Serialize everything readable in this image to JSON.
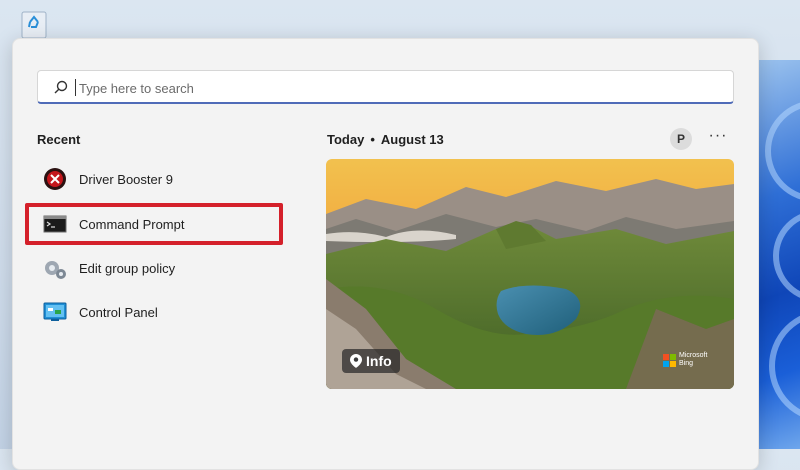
{
  "search": {
    "placeholder": "Type here to search"
  },
  "recent": {
    "label": "Recent",
    "items": [
      {
        "label": "Driver Booster 9",
        "icon": "driver-booster-icon"
      },
      {
        "label": "Command Prompt",
        "icon": "command-prompt-icon"
      },
      {
        "label": "Edit group policy",
        "icon": "group-policy-icon"
      },
      {
        "label": "Control Panel",
        "icon": "control-panel-icon"
      }
    ]
  },
  "today": {
    "label": "Today",
    "separator": "•",
    "date": "August 13"
  },
  "account": {
    "initial": "P"
  },
  "more": {
    "label": "···"
  },
  "bing_card": {
    "info_label": "Info",
    "brand_line1": "Microsoft",
    "brand_line2": "Bing"
  },
  "colors": {
    "highlight": "#d4202a",
    "search_underline": "#4f6bb8",
    "menu_bg": "#f3f3f3"
  }
}
